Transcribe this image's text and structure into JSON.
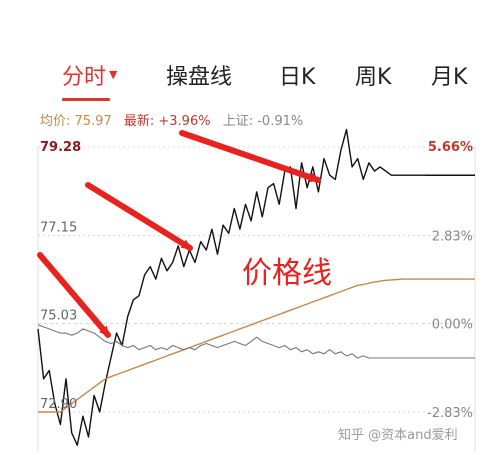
{
  "tabs": [
    {
      "label": "分时",
      "active": true
    },
    {
      "label": "操盘线",
      "active": false
    },
    {
      "label": "日K",
      "active": false
    },
    {
      "label": "周K",
      "active": false
    },
    {
      "label": "月K",
      "active": false
    }
  ],
  "stats": {
    "avg_label": "均价: 75.97",
    "latest_label": "最新: +3.96%",
    "index_label": "上证: -0.91%"
  },
  "colors": {
    "accent": "#d9372f",
    "price_line": "#111111",
    "avg_line": "#c8874a",
    "index_line": "#777777",
    "arrow": "#e8231f"
  },
  "chart_data": {
    "type": "line",
    "title": "",
    "xlabel": "",
    "ylabel": "",
    "y_left_ticks": [
      "79.28",
      "77.15",
      "75.03",
      "72.90"
    ],
    "y_right_ticks": [
      "5.66%",
      "2.83%",
      "0.00%",
      "-2.83%"
    ],
    "ylim": [
      72.9,
      79.28
    ],
    "annotation": "价格线",
    "series": [
      {
        "name": "",
        "role": "price",
        "values": [
          74.9,
          73.7,
          73.9,
          73.1,
          72.6,
          73.7,
          72.4,
          72.1,
          72.8,
          72.3,
          73.3,
          72.9,
          73.6,
          74.2,
          74.8,
          74.5,
          75.2,
          75.6,
          75.7,
          76.2,
          76.4,
          76.1,
          76.6,
          76.3,
          76.5,
          76.9,
          76.4,
          76.8,
          76.5,
          77.0,
          76.8,
          77.3,
          76.7,
          77.4,
          77.2,
          77.8,
          77.3,
          77.9,
          77.5,
          78.2,
          77.6,
          78.3,
          78.4,
          77.9,
          78.7,
          78.8,
          77.8,
          78.9,
          78.3,
          78.8,
          78.2,
          79.0,
          78.6,
          78.5,
          79.2,
          79.7,
          78.8,
          79.0,
          78.5,
          78.9,
          78.7,
          78.8,
          78.7,
          78.6,
          78.6,
          78.6,
          78.6,
          78.6,
          78.6,
          78.6
        ]
      },
      {
        "name": "",
        "role": "average",
        "values": [
          72.9,
          72.9,
          72.9,
          72.9,
          72.9,
          73.0,
          73.1,
          73.2,
          73.3,
          73.4,
          73.5,
          73.6,
          73.7,
          73.75,
          73.8,
          73.85,
          73.9,
          73.95,
          74.0,
          74.05,
          74.1,
          74.15,
          74.2,
          74.25,
          74.3,
          74.35,
          74.4,
          74.45,
          74.5,
          74.55,
          74.6,
          74.65,
          74.7,
          74.75,
          74.8,
          74.85,
          74.9,
          74.95,
          75.0,
          75.05,
          75.1,
          75.15,
          75.2,
          75.25,
          75.3,
          75.35,
          75.4,
          75.45,
          75.5,
          75.55,
          75.6,
          75.65,
          75.7,
          75.75,
          75.8,
          75.85,
          75.9,
          75.95,
          75.97,
          76.0,
          76.03,
          76.05,
          76.07,
          76.08,
          76.09,
          76.1,
          76.1,
          76.1,
          76.1,
          76.1
        ]
      },
      {
        "name": "",
        "role": "index",
        "values": [
          75.0,
          74.95,
          74.9,
          74.85,
          74.8,
          74.8,
          74.75,
          74.8,
          74.9,
          74.85,
          74.8,
          74.7,
          74.6,
          74.55,
          74.6,
          74.5,
          74.45,
          74.5,
          74.4,
          74.45,
          74.5,
          74.4,
          74.45,
          74.4,
          74.5,
          74.45,
          74.4,
          74.45,
          74.4,
          74.5,
          74.55,
          74.5,
          74.45,
          74.5,
          74.55,
          74.6,
          74.55,
          74.5,
          74.6,
          74.7,
          74.6,
          74.55,
          74.5,
          74.45,
          74.5,
          74.4,
          74.45,
          74.35,
          74.4,
          74.3,
          74.35,
          74.3,
          74.4,
          74.3,
          74.35,
          74.25,
          74.3,
          74.2,
          74.25,
          74.2,
          74.2,
          74.2,
          74.2,
          74.2,
          74.2,
          74.2,
          74.2,
          74.2,
          74.2,
          74.2
        ]
      }
    ]
  },
  "watermark": "知乎 @资本and爱利"
}
